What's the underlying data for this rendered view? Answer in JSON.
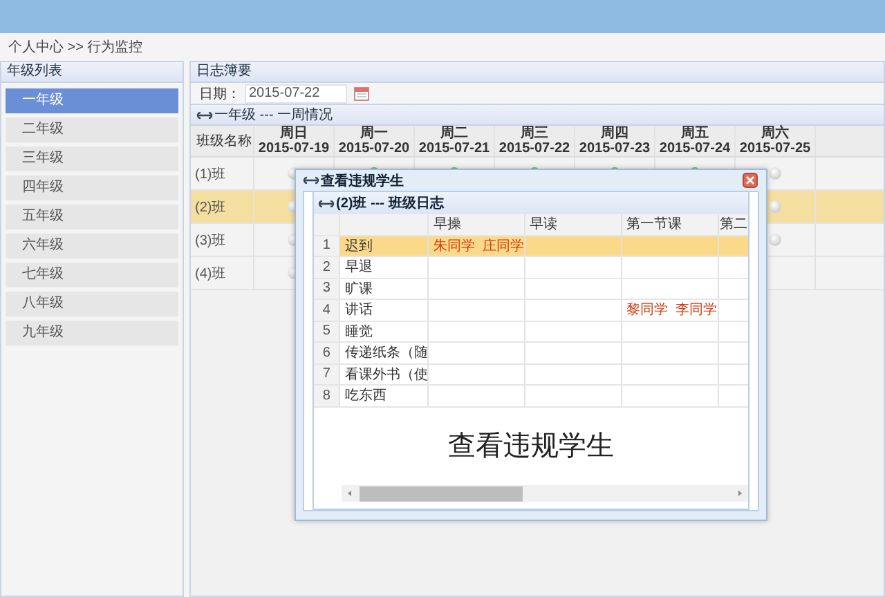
{
  "breadcrumb": "个人中心 >> 行为监控",
  "sidebar": {
    "title": "年级列表",
    "items": [
      {
        "label": "一年级",
        "selected": true
      },
      {
        "label": "二年级",
        "selected": false
      },
      {
        "label": "三年级",
        "selected": false
      },
      {
        "label": "四年级",
        "selected": false
      },
      {
        "label": "五年级",
        "selected": false
      },
      {
        "label": "六年级",
        "selected": false
      },
      {
        "label": "七年级",
        "selected": false
      },
      {
        "label": "八年级",
        "selected": false
      },
      {
        "label": "九年级",
        "selected": false
      }
    ]
  },
  "main": {
    "title": "日志簿要",
    "date": {
      "label": "日期：",
      "value": "2015-07-22"
    },
    "week": {
      "title": "一年级 --- 一周情况",
      "name_header": "班级名称",
      "columns": [
        {
          "day": "周日",
          "date": "2015-07-19"
        },
        {
          "day": "周一",
          "date": "2015-07-20"
        },
        {
          "day": "周二",
          "date": "2015-07-21"
        },
        {
          "day": "周三",
          "date": "2015-07-22"
        },
        {
          "day": "周四",
          "date": "2015-07-23"
        },
        {
          "day": "周五",
          "date": "2015-07-24"
        },
        {
          "day": "周六",
          "date": "2015-07-25"
        }
      ],
      "rows": [
        {
          "name": "(1)班",
          "selected": false,
          "dots": [
            {
              "kind": "pending"
            },
            {
              "kind": "done"
            },
            {
              "kind": "done"
            },
            {
              "kind": "done"
            },
            {
              "kind": "done"
            },
            {
              "kind": "done"
            },
            {
              "kind": "pending"
            }
          ]
        },
        {
          "name": "(2)班",
          "selected": true,
          "dots": [
            {
              "kind": "pending"
            },
            {
              "kind": "covered"
            },
            {
              "kind": "covered"
            },
            {
              "kind": "covered"
            },
            {
              "kind": "covered"
            },
            {
              "kind": "covered"
            },
            {
              "kind": "pending"
            }
          ]
        },
        {
          "name": "(3)班",
          "selected": false,
          "dots": [
            {
              "kind": "pending"
            },
            {
              "kind": "covered"
            },
            {
              "kind": "covered"
            },
            {
              "kind": "covered"
            },
            {
              "kind": "covered"
            },
            {
              "kind": "covered"
            },
            {
              "kind": "pending"
            }
          ]
        },
        {
          "name": "(4)班",
          "selected": false,
          "dots": [
            {
              "kind": "pending"
            },
            {
              "kind": "covered"
            },
            {
              "kind": "covered"
            },
            {
              "kind": "covered"
            },
            {
              "kind": "covered"
            },
            {
              "kind": "covered"
            },
            {
              "kind": "blank"
            }
          ]
        }
      ]
    }
  },
  "dialog": {
    "title": "查看违规学生",
    "panel_title": "(2)班 --- 班级日志",
    "columns": [
      "早操",
      "早读",
      "第一节课",
      "第二"
    ],
    "rows": [
      {
        "index": "1",
        "name": "迟到",
        "selected": true,
        "cells": [
          "朱同学  庄同学",
          null,
          null,
          null
        ]
      },
      {
        "index": "2",
        "name": "早退",
        "selected": false,
        "cells": [
          null,
          null,
          null,
          null
        ]
      },
      {
        "index": "3",
        "name": "旷课",
        "selected": false,
        "cells": [
          null,
          null,
          null,
          null
        ]
      },
      {
        "index": "4",
        "name": "讲话",
        "selected": false,
        "cells": [
          null,
          null,
          "黎同学  李同学",
          null
        ]
      },
      {
        "index": "5",
        "name": "睡觉",
        "selected": false,
        "cells": [
          null,
          null,
          null,
          null
        ]
      },
      {
        "index": "6",
        "name": "传递纸条（随",
        "selected": false,
        "cells": [
          null,
          null,
          null,
          null
        ]
      },
      {
        "index": "7",
        "name": "看课外书（使",
        "selected": false,
        "cells": [
          null,
          null,
          null,
          null
        ]
      },
      {
        "index": "8",
        "name": "吃东西",
        "selected": false,
        "cells": [
          null,
          null,
          null,
          null
        ]
      }
    ],
    "caption": "查看违规学生"
  }
}
